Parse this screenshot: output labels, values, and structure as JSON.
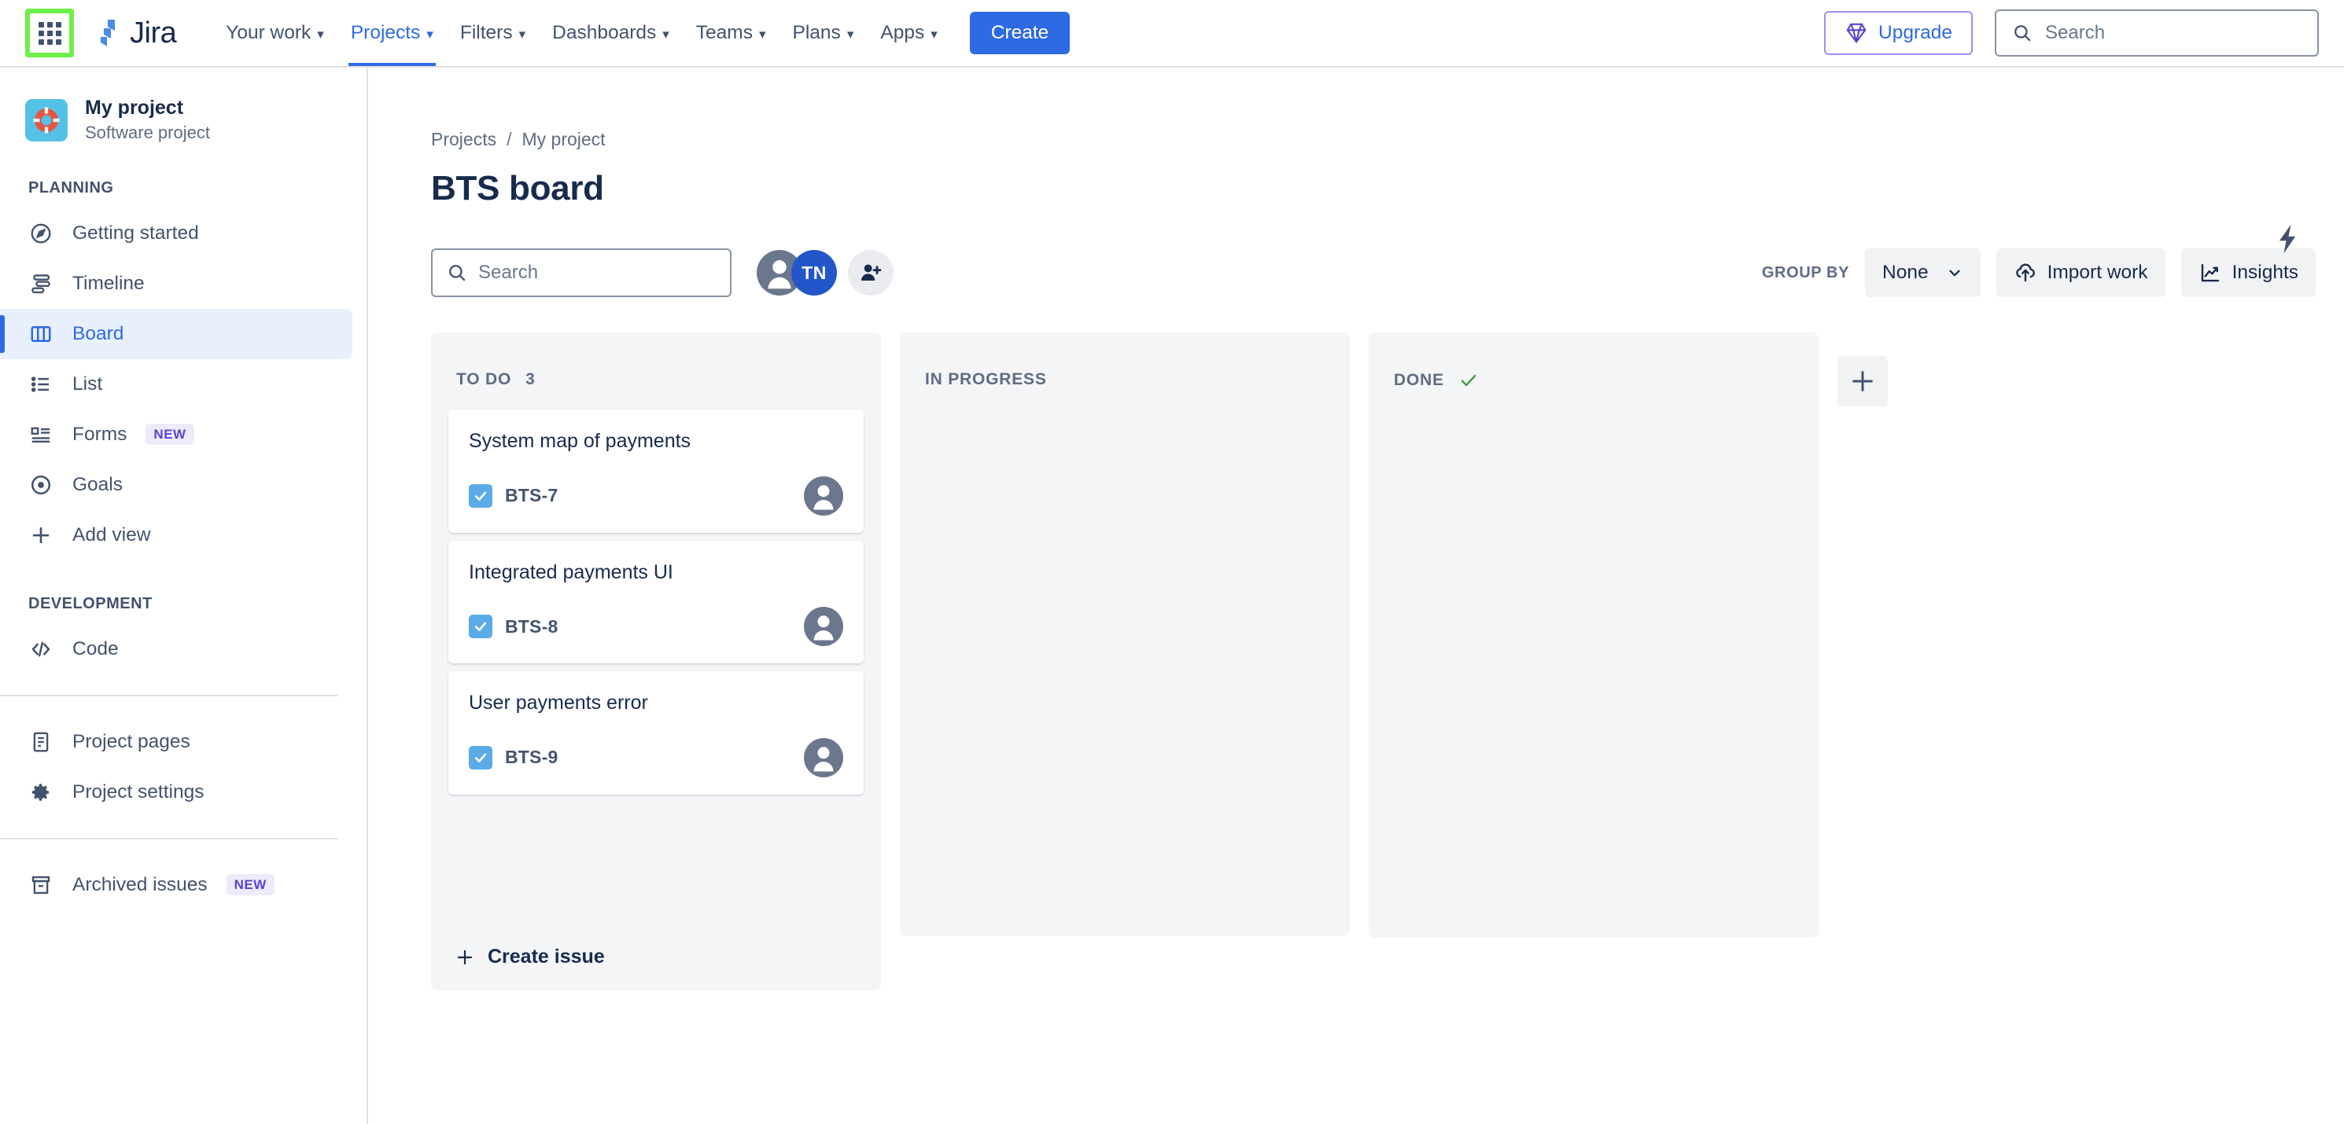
{
  "topnav": {
    "app_switcher_label": "app-switcher",
    "brand": "Jira",
    "items": [
      {
        "label": "Your work",
        "has_caret": true,
        "active": false
      },
      {
        "label": "Projects",
        "has_caret": true,
        "active": true
      },
      {
        "label": "Filters",
        "has_caret": true,
        "active": false
      },
      {
        "label": "Dashboards",
        "has_caret": true,
        "active": false
      },
      {
        "label": "Teams",
        "has_caret": true,
        "active": false
      },
      {
        "label": "Plans",
        "has_caret": true,
        "active": false
      },
      {
        "label": "Apps",
        "has_caret": true,
        "active": false
      }
    ],
    "create_label": "Create",
    "upgrade_label": "Upgrade",
    "search_placeholder": "Search",
    "accent_blue": "#2D6AE3",
    "upgrade_border": "#9F8FEF",
    "highlight_green": "#6EF04A"
  },
  "sidebar": {
    "project_name": "My project",
    "project_type": "Software project",
    "project_avatar_icon": "lifebuoy-icon",
    "sections": [
      {
        "label": "PLANNING",
        "items": [
          {
            "label": "Getting started",
            "icon": "compass-icon",
            "selected": false,
            "badge": ""
          },
          {
            "label": "Timeline",
            "icon": "timeline-icon",
            "selected": false,
            "badge": ""
          },
          {
            "label": "Board",
            "icon": "board-icon",
            "selected": true,
            "badge": ""
          },
          {
            "label": "List",
            "icon": "list-icon",
            "selected": false,
            "badge": ""
          },
          {
            "label": "Forms",
            "icon": "forms-icon",
            "selected": false,
            "badge": "NEW"
          },
          {
            "label": "Goals",
            "icon": "goals-icon",
            "selected": false,
            "badge": ""
          },
          {
            "label": "Add view",
            "icon": "plus-icon",
            "selected": false,
            "badge": ""
          }
        ]
      },
      {
        "label": "DEVELOPMENT",
        "items": [
          {
            "label": "Code",
            "icon": "code-icon",
            "selected": false,
            "badge": ""
          }
        ]
      }
    ],
    "footer_items": [
      {
        "label": "Project pages",
        "icon": "page-icon",
        "badge": ""
      },
      {
        "label": "Project settings",
        "icon": "gear-icon",
        "badge": ""
      }
    ],
    "archived": {
      "label": "Archived issues",
      "icon": "archive-icon",
      "badge": "NEW"
    }
  },
  "main": {
    "breadcrumb": {
      "root": "Projects",
      "separator": "/",
      "current": "My project"
    },
    "page_title": "BTS board",
    "automation_icon": "lightning-bolt-icon",
    "toolbar": {
      "search_placeholder": "Search",
      "avatars": [
        {
          "type": "default",
          "initials": ""
        },
        {
          "type": "initials",
          "initials": "TN"
        }
      ],
      "add_people_label": "add-people",
      "group_by_label": "GROUP BY",
      "group_by_value": "None",
      "import_label": "Import work",
      "insights_label": "Insights"
    },
    "columns": [
      {
        "title": "TO DO",
        "count": "3",
        "done": false,
        "cards": [
          {
            "title": "System map of payments",
            "key": "BTS-7",
            "type_icon": "task-icon",
            "assignee": "unassigned"
          },
          {
            "title": "Integrated payments UI",
            "key": "BTS-8",
            "type_icon": "task-icon",
            "assignee": "unassigned"
          },
          {
            "title": "User payments error",
            "key": "BTS-9",
            "type_icon": "task-icon",
            "assignee": "unassigned"
          }
        ],
        "create_issue_label": "Create issue"
      },
      {
        "title": "IN PROGRESS",
        "count": "",
        "done": false,
        "cards": [],
        "create_issue_label": ""
      },
      {
        "title": "DONE",
        "count": "",
        "done": true,
        "cards": [],
        "create_issue_label": ""
      }
    ],
    "add_column_label": "+"
  }
}
